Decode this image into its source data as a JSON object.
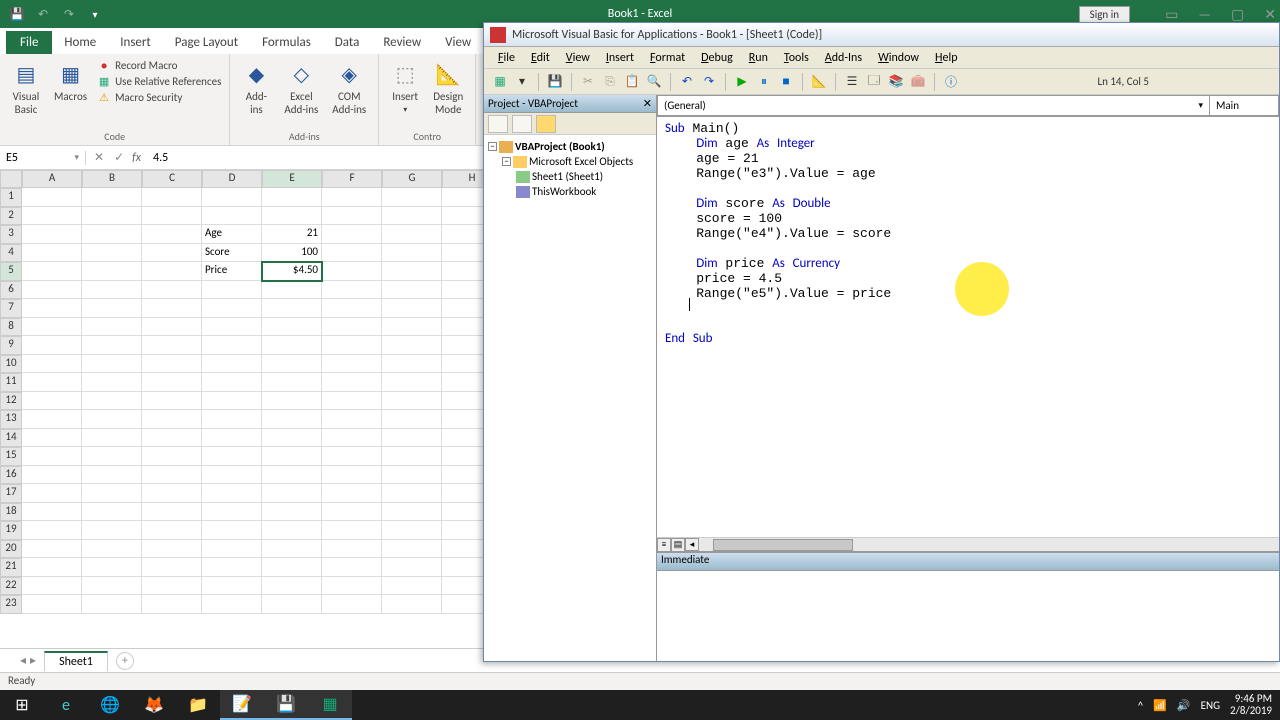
{
  "excel": {
    "title": "Book1 - Excel",
    "signin": "Sign in",
    "tabs": {
      "file": "File",
      "home": "Home",
      "insert": "Insert",
      "pagelayout": "Page Layout",
      "formulas": "Formulas",
      "data": "Data",
      "review": "Review",
      "view": "View"
    },
    "ribbon": {
      "group_code": "Code",
      "visual_basic": "Visual\nBasic",
      "macros": "Macros",
      "record_macro": "Record Macro",
      "use_relative": "Use Relative References",
      "macro_security": "Macro Security",
      "group_addins": "Add-ins",
      "addins": "Add-\nins",
      "excel_addins": "Excel\nAdd-ins",
      "com_addins": "COM\nAdd-ins",
      "insert": "Insert",
      "design_mode": "Design\nMode",
      "group_controls": "Contro"
    },
    "namebox": "E5",
    "formula": "4.5",
    "columns": [
      "A",
      "B",
      "C",
      "D",
      "E",
      "F",
      "G",
      "H"
    ],
    "cells": {
      "D3": "Age",
      "E3": "21",
      "D4": "Score",
      "E4": "100",
      "D5": "Price",
      "E5": "$4.50"
    },
    "selected": {
      "col": "E",
      "row": 5
    },
    "sheet_tab": "Sheet1",
    "status": "Ready"
  },
  "vbe": {
    "title": "Microsoft Visual Basic for Applications - Book1 - [Sheet1 (Code)]",
    "menu": [
      "File",
      "Edit",
      "View",
      "Insert",
      "Format",
      "Debug",
      "Run",
      "Tools",
      "Add-Ins",
      "Window",
      "Help"
    ],
    "lncol": "Ln 14, Col 5",
    "project_title": "Project - VBAProject",
    "tree": {
      "project": "VBAProject (Book1)",
      "folder": "Microsoft Excel Objects",
      "sheet": "Sheet1 (Sheet1)",
      "workbook": "ThisWorkbook"
    },
    "dd_left": "(General)",
    "dd_right": "Main",
    "code_plain": "Sub Main()\n    Dim age As Integer\n    age = 21\n    Range(\"e3\").Value = age\n\n    Dim score As Double\n    score = 100\n    Range(\"e4\").Value = score\n\n    Dim price As Currency\n    price = 4.5\n    Range(\"e5\").Value = price\n\n    \nEnd Sub",
    "immediate": "Immediate"
  },
  "taskbar": {
    "lang": "ENG",
    "time": "9:46 PM",
    "date": "2/8/2019"
  }
}
